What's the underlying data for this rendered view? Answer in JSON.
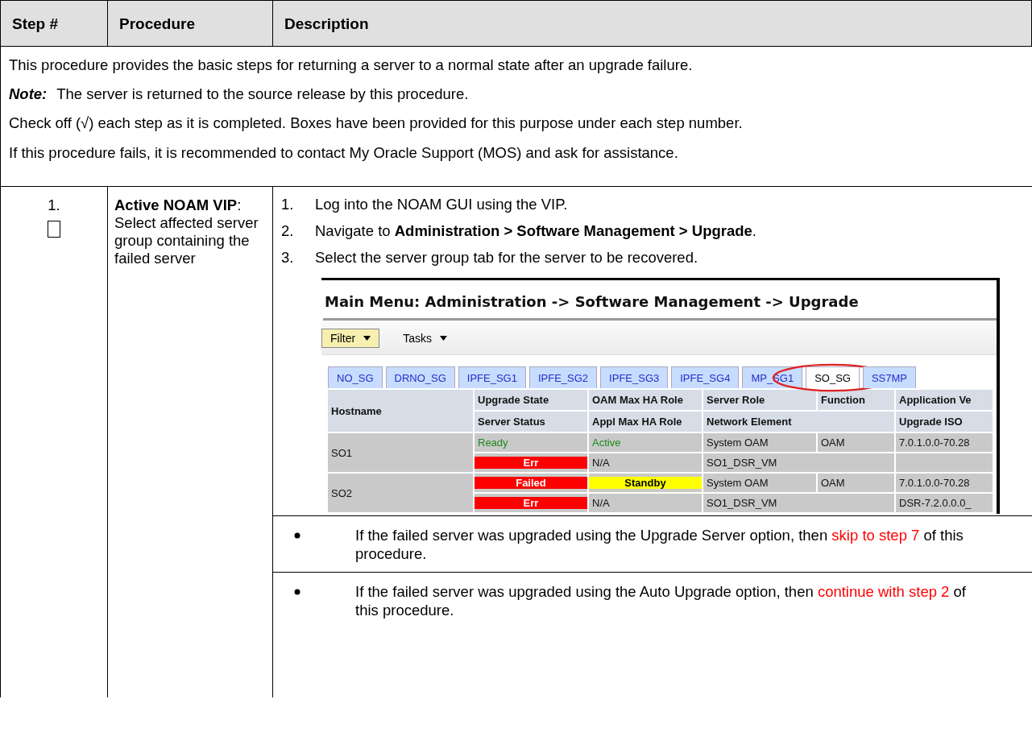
{
  "table": {
    "columns": [
      "Step #",
      "Procedure",
      "Description"
    ],
    "intro": [
      {
        "kind": "text",
        "text": "This procedure provides the basic steps for returning a server to a normal state after an upgrade failure."
      },
      {
        "kind": "note",
        "label": "Note:",
        "text": "The server is returned to the source release by this procedure."
      },
      {
        "kind": "text",
        "text": "Check off (√) each step as it is completed.  Boxes have been provided for this purpose under each step number."
      },
      {
        "kind": "text",
        "text": "If this procedure fails, it is recommended to contact My Oracle Support (MOS) and ask for assistance."
      }
    ],
    "steps": [
      {
        "number": "1.",
        "checked": false,
        "procedure": "**Active NOAM VIP**:  Select affected server group containing the failed server",
        "substeps": [
          {
            "number": "1.",
            "text": "Log into the NOAM GUI using the VIP."
          },
          {
            "number": "2.",
            "text": "Navigate to **Administration > Software Management > Upgrade**."
          },
          {
            "number": "3.",
            "text": "Select the server group tab for the server to be recovered."
          }
        ],
        "screenshot": {
          "title": "Main Menu: Administration -> Software Management -> Upgrade",
          "toolbar": [
            {
              "label": "Filter",
              "highlighted": true
            },
            {
              "label": "Tasks",
              "highlighted": false
            }
          ],
          "tabs": [
            {
              "label": "NO_SG",
              "selected": false
            },
            {
              "label": "DRNO_SG",
              "selected": false
            },
            {
              "label": "IPFE_SG1",
              "selected": false
            },
            {
              "label": "IPFE_SG2",
              "selected": false
            },
            {
              "label": "IPFE_SG3",
              "selected": false
            },
            {
              "label": "IPFE_SG4",
              "selected": false
            },
            {
              "label": "MP_SG1",
              "selected": false
            },
            {
              "label": "SO_SG",
              "selected": true
            },
            {
              "label": "SS7MP",
              "selected": false
            }
          ],
          "header_top": [
            "Hostname",
            "Upgrade State",
            "OAM Max HA Role",
            "Server Role",
            "Function",
            "Application Ve"
          ],
          "header_bottom": [
            "Server Status",
            "Appl Max HA Role",
            "Network Element",
            "Upgrade ISO"
          ],
          "rows": [
            {
              "hostname": "SO1",
              "upgrade_state": {
                "text": "Ready",
                "kind": "ok"
              },
              "oam_role": {
                "text": "Active",
                "kind": "ok"
              },
              "server_role": "System OAM",
              "function": "OAM",
              "app_version": "7.0.1.0.0-70.28",
              "server_status": {
                "text": "Err",
                "kind": "error"
              },
              "appl_role": {
                "text": "N/A",
                "kind": "plain"
              },
              "network_element": "SO1_DSR_VM"
            },
            {
              "hostname": "SO2",
              "upgrade_state": {
                "text": "Failed",
                "kind": "error"
              },
              "oam_role": {
                "text": "Standby",
                "kind": "warning"
              },
              "server_role": "System OAM",
              "function": "OAM",
              "app_version": "7.0.1.0.0-70.28",
              "server_status": {
                "text": "Err",
                "kind": "error"
              },
              "appl_role": {
                "text": "N/A",
                "kind": "plain"
              },
              "network_element": "SO1_DSR_VM",
              "upgrade_iso": "DSR-7.2.0.0.0_"
            }
          ]
        },
        "bullets": [
          {
            "text": "If the failed server was upgraded using the Upgrade Server option, then",
            "link": "skip to step 7",
            "after": "of this procedure."
          },
          {
            "text": "If the failed server was upgraded using the Auto Upgrade option, then",
            "link": "continue with step 2",
            "after": "of this procedure."
          }
        ]
      }
    ]
  }
}
